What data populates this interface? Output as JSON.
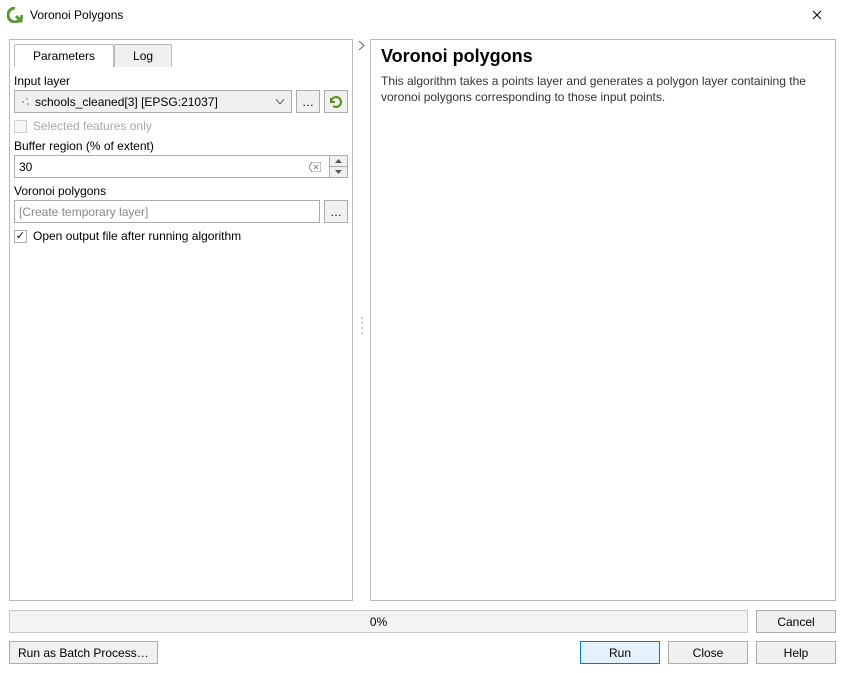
{
  "window": {
    "title": "Voronoi Polygons"
  },
  "tabs": {
    "parameters": "Parameters",
    "log": "Log"
  },
  "params": {
    "input_layer_label": "Input layer",
    "input_layer_value": "schools_cleaned[3] [EPSG:21037]",
    "selected_only_label": "Selected features only",
    "selected_only_checked": false,
    "buffer_label": "Buffer region (% of extent)",
    "buffer_value": "30",
    "output_label": "Voronoi polygons",
    "output_placeholder": "[Create temporary layer]",
    "open_output_label": "Open output file after running algorithm",
    "open_output_checked": true
  },
  "help": {
    "title": "Voronoi polygons",
    "body": "This algorithm takes a points layer and generates a polygon layer containing the voronoi polygons corresponding to those input points."
  },
  "progress_text": "0%",
  "buttons": {
    "cancel": "Cancel",
    "batch": "Run as Batch Process…",
    "run": "Run",
    "close": "Close",
    "help": "Help",
    "browse": "…"
  }
}
